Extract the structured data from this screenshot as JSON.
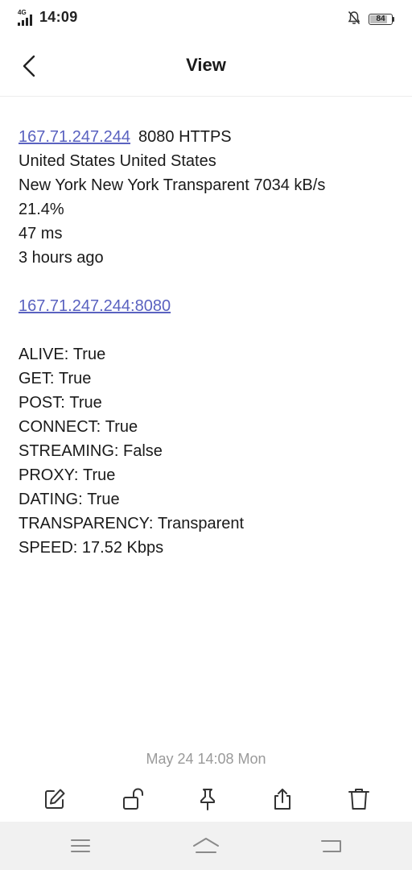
{
  "status_bar": {
    "network": "4G",
    "time": "14:09",
    "battery": "84",
    "battery_level": 0.84
  },
  "header": {
    "title": "View"
  },
  "note": {
    "ip_link": "167.71.247.244",
    "port_protocol": "8080 HTTPS",
    "country_line": "United States United States",
    "location_line": "New York New York Transparent 7034 kB/s",
    "uptime": "21.4%",
    "latency": "47 ms",
    "checked": "3 hours ago",
    "proxy_link": "167.71.247.244:8080",
    "checks": [
      {
        "label": "ALIVE:",
        "value": "True"
      },
      {
        "label": "GET:",
        "value": "True"
      },
      {
        "label": "POST:",
        "value": "True"
      },
      {
        "label": "CONNECT:",
        "value": "True"
      },
      {
        "label": "STREAMING:",
        "value": "False"
      },
      {
        "label": "PROXY:",
        "value": "True"
      },
      {
        "label": "DATING:",
        "value": "True"
      },
      {
        "label": "TRANSPARENCY:",
        "value": "Transparent"
      },
      {
        "label": "SPEED:",
        "value": "17.52 Kbps"
      }
    ]
  },
  "footer": {
    "timestamp": "May 24 14:08 Mon"
  },
  "toolbar": {
    "icons": [
      "edit-icon",
      "unlock-icon",
      "pin-icon",
      "share-icon",
      "delete-icon"
    ]
  },
  "colors": {
    "link": "#5a62c0",
    "timestamp": "#9a9a9a",
    "navbar": "#f1f1f1"
  }
}
